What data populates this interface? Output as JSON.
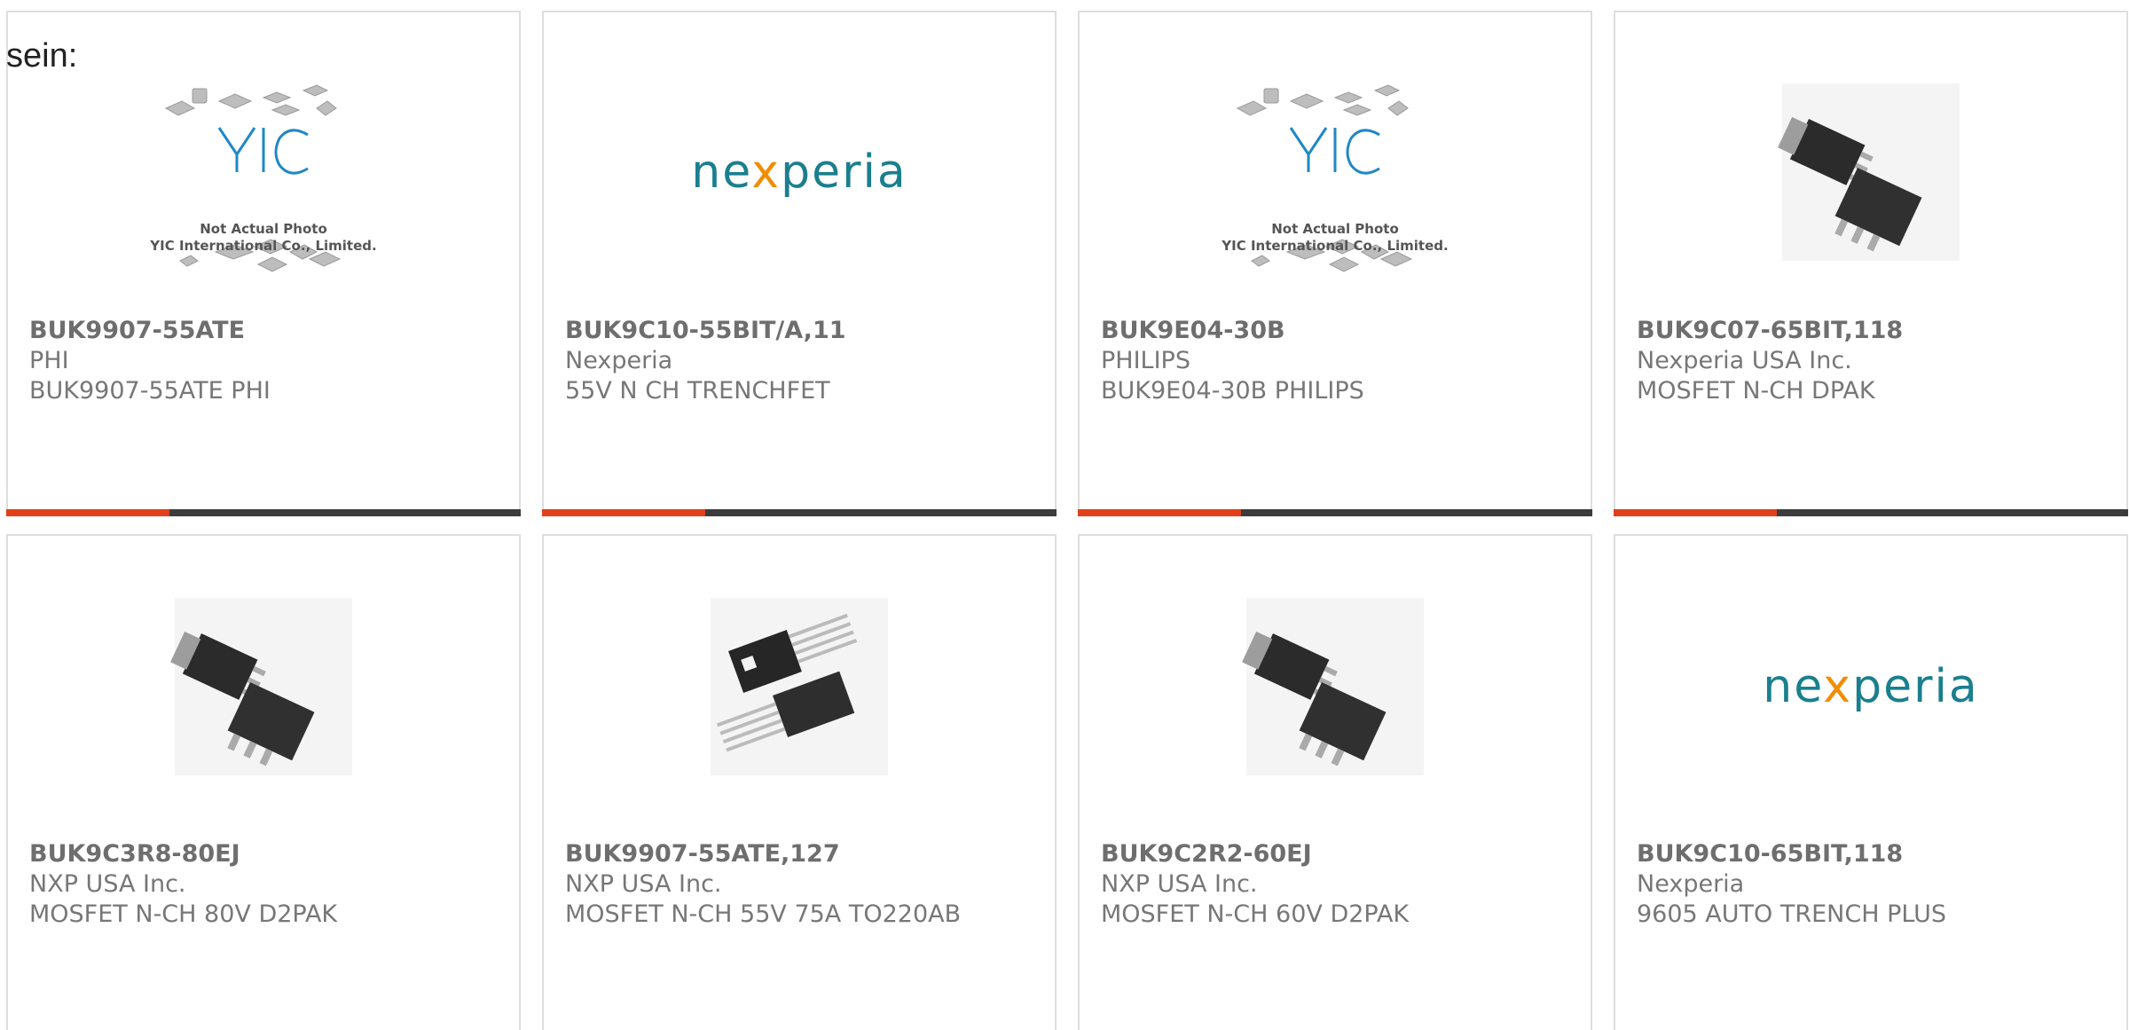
{
  "prefix": "sein:",
  "colors": {
    "accent": "#e0401a",
    "bar": "#3c3c3c",
    "nexperia": "#1a7f8e",
    "nexperia_x": "#f28c00"
  },
  "products": [
    {
      "part": "BUK9907-55ATE",
      "mfr": "PHI",
      "desc": "BUK9907-55ATE PHI",
      "image": "yic-placeholder"
    },
    {
      "part": "BUK9C10-55BIT/A,11",
      "mfr": "Nexperia",
      "desc": "55V N CH TRENCHFET",
      "image": "nexperia-logo"
    },
    {
      "part": "BUK9E04-30B",
      "mfr": "PHILIPS",
      "desc": "BUK9E04-30B PHILIPS",
      "image": "yic-placeholder"
    },
    {
      "part": "BUK9C07-65BIT,118",
      "mfr": "Nexperia USA Inc.",
      "desc": "MOSFET N-CH DPAK",
      "image": "d2pak-chip"
    },
    {
      "part": "BUK9C3R8-80EJ",
      "mfr": "NXP USA Inc.",
      "desc": "MOSFET N-CH 80V D2PAK",
      "image": "d2pak-chip"
    },
    {
      "part": "BUK9907-55ATE,127",
      "mfr": "NXP USA Inc.",
      "desc": "MOSFET N-CH 55V 75A TO220AB",
      "image": "to220-chip"
    },
    {
      "part": "BUK9C2R2-60EJ",
      "mfr": "NXP USA Inc.",
      "desc": "MOSFET N-CH 60V D2PAK",
      "image": "d2pak-chip"
    },
    {
      "part": "BUK9C10-65BIT,118",
      "mfr": "Nexperia",
      "desc": "9605 AUTO TRENCH PLUS",
      "image": "nexperia-logo"
    }
  ],
  "yic": {
    "brand": "YIC",
    "line1": "Not Actual Photo",
    "line2": "YIC International Co., Limited."
  },
  "nexperia": {
    "pre": "ne",
    "x": "x",
    "post": "peria"
  }
}
